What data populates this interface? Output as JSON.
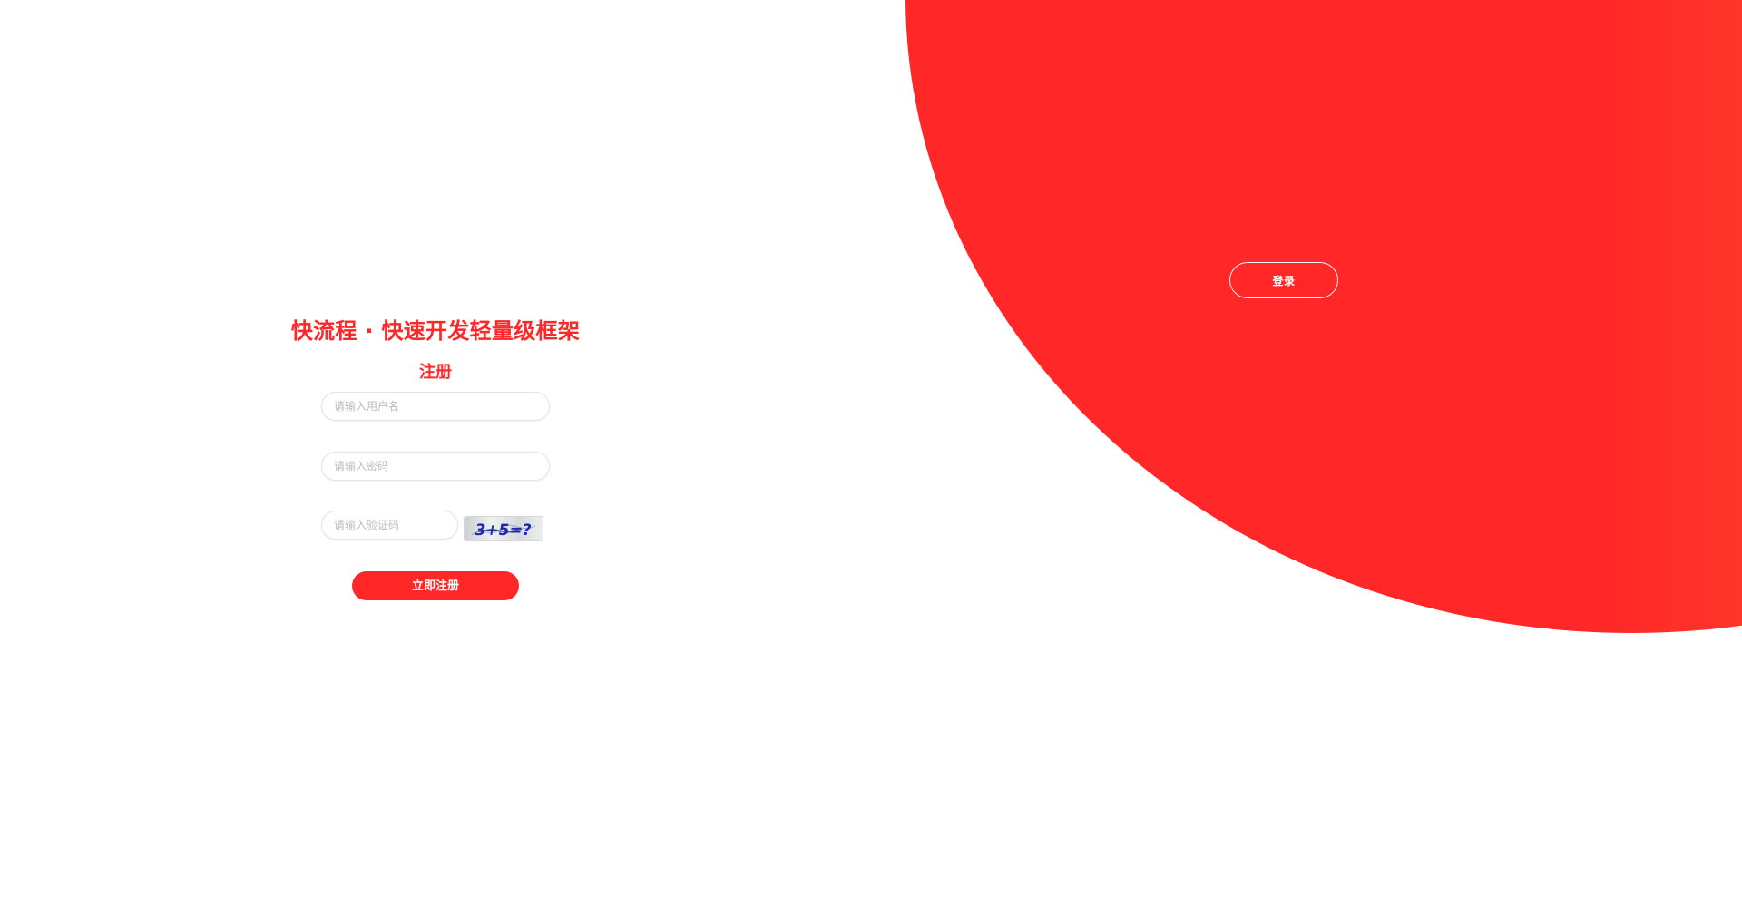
{
  "colors": {
    "brand": "#ff2727",
    "gradient_start": "#ff2727",
    "gradient_end": "#ff7b2f",
    "background": "#ffffff"
  },
  "hero": {
    "login_button_label": "登录"
  },
  "register": {
    "title": "快流程 · 快速开发轻量级框架",
    "subtitle": "注册",
    "username_placeholder": "请输入用户名",
    "password_placeholder": "请输入密码",
    "captcha_placeholder": "请输入验证码",
    "captcha_text": "3+5=?",
    "submit_label": "立即注册"
  }
}
